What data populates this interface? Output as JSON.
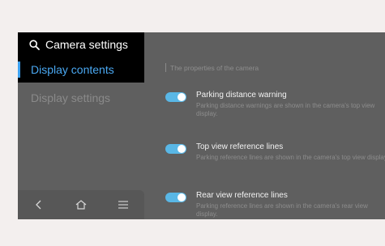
{
  "nav": {
    "title": "Camera settings",
    "active_item": "Display contents",
    "item": "Display settings"
  },
  "bottom_nav": {
    "back": "back-icon",
    "home": "home-icon",
    "menu": "menu-icon"
  },
  "content": {
    "section_heading": "The properties of the camera",
    "settings": [
      {
        "label": "Parking distance warning",
        "description": "Parking distance warnings are shown in the camera's top view display.",
        "enabled": true
      },
      {
        "label": "Top view reference lines",
        "description": "Parking reference lines are shown in the camera's top view display.",
        "enabled": true
      },
      {
        "label": "Rear view reference lines",
        "description": "Parking reference lines are shown in the camera's rear view display.",
        "enabled": true
      }
    ]
  },
  "colors": {
    "accent": "#3ea2f1",
    "toggle_on": "#59b7e6",
    "background": "#5f5f5f"
  }
}
